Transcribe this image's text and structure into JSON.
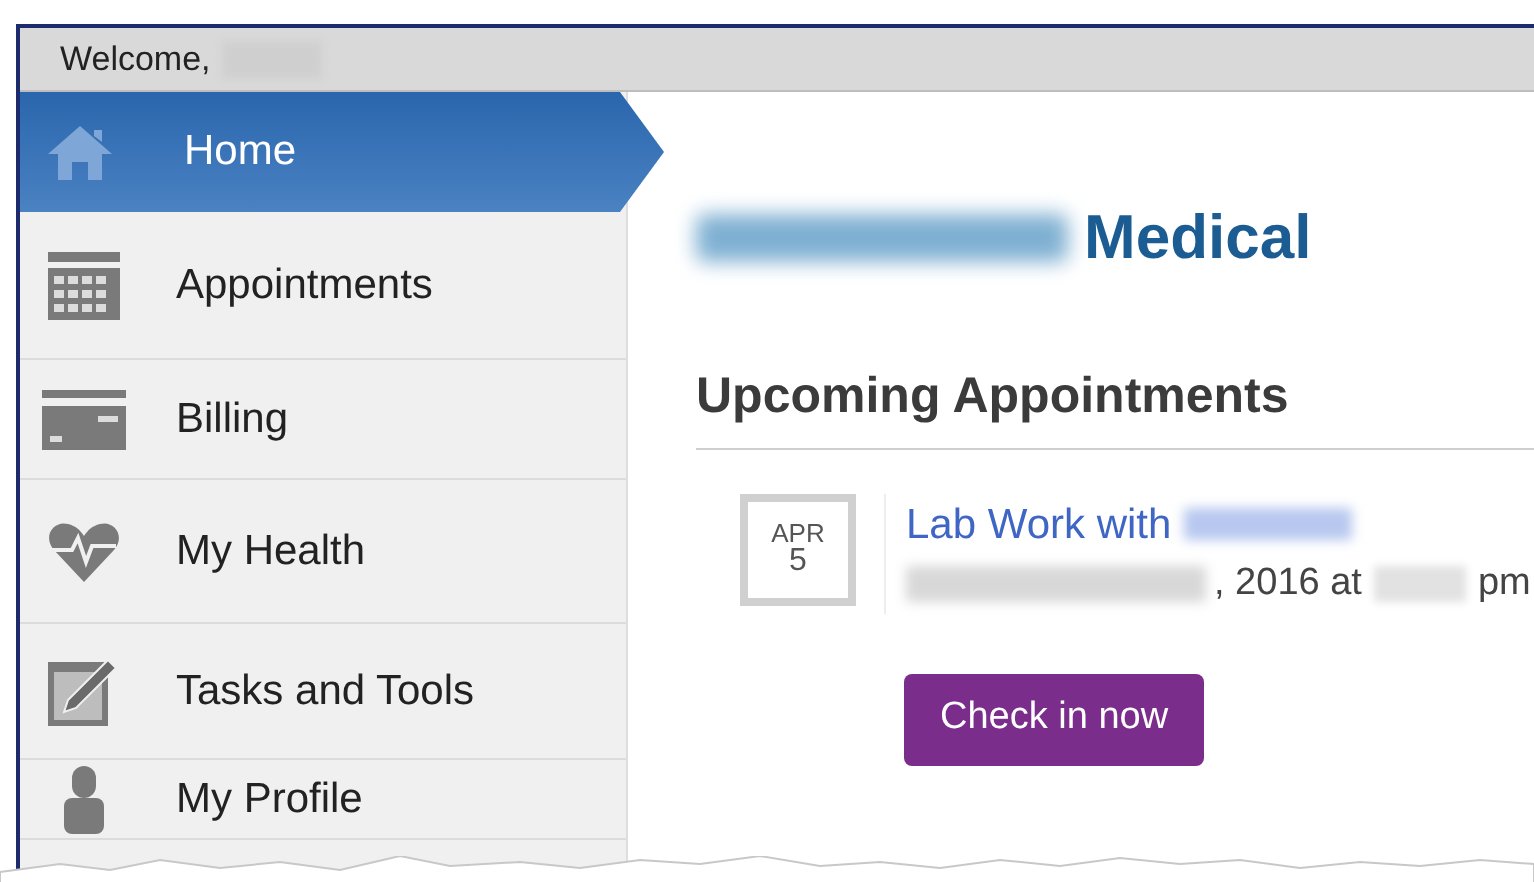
{
  "header": {
    "welcome": "Welcome,"
  },
  "sidebar": {
    "items": [
      {
        "label": "Home",
        "selected": true
      },
      {
        "label": "Appointments",
        "selected": false
      },
      {
        "label": "Billing",
        "selected": false
      },
      {
        "label": "My Health",
        "selected": false
      },
      {
        "label": "Tasks and Tools",
        "selected": false
      },
      {
        "label": "My Profile",
        "selected": false
      }
    ]
  },
  "main": {
    "title_suffix": "Medical",
    "section_title": "Upcoming Appointments",
    "appointments": [
      {
        "month": "APR",
        "day": "5",
        "title": "Lab Work with",
        "date_mid": ", 2016 at",
        "date_end": "pm",
        "action": "Check in now"
      }
    ]
  }
}
